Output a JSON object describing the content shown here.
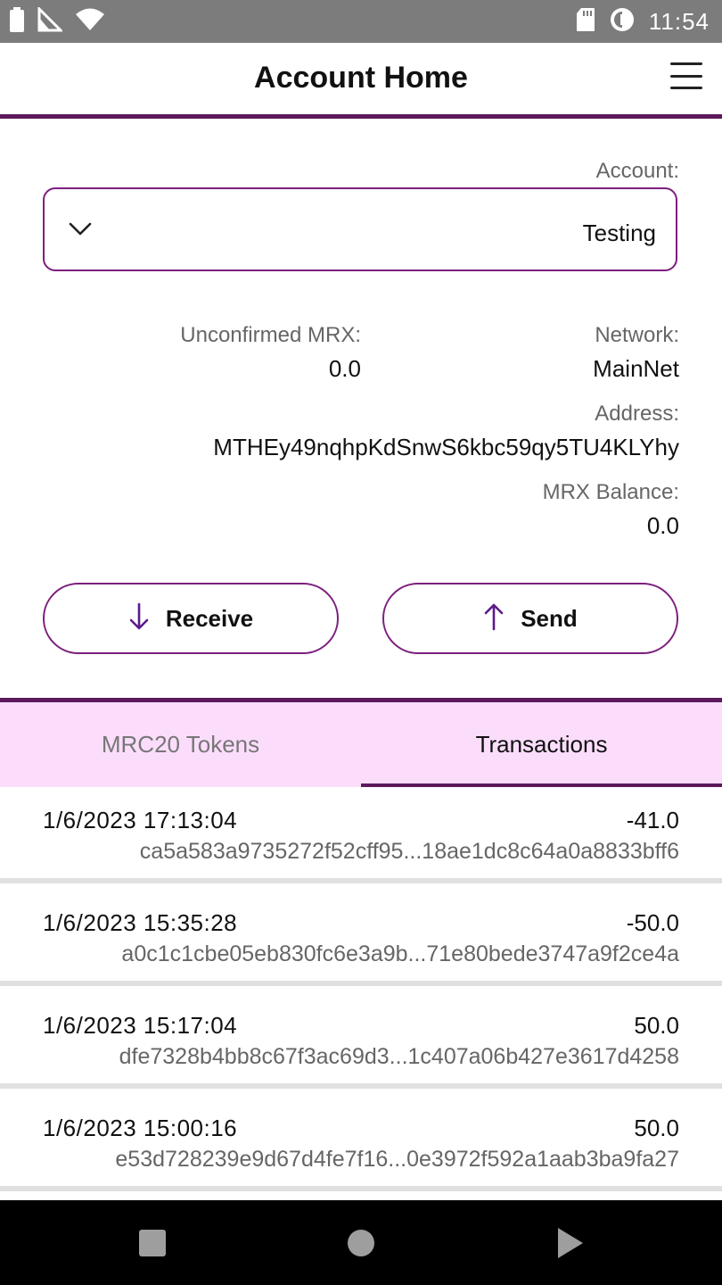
{
  "status_bar": {
    "time": "11:54",
    "icons_left": [
      "battery-icon",
      "signal-icon",
      "wifi-icon"
    ],
    "icons_right": [
      "sd-card-icon",
      "sync-icon"
    ]
  },
  "app_bar": {
    "title": "Account Home",
    "menu_icon": "hamburger-menu-icon"
  },
  "account": {
    "label": "Account:",
    "selected": "Testing"
  },
  "info": {
    "network_label": "Network:",
    "network_value": "MainNet",
    "unconfirmed_label": "Unconfirmed MRX:",
    "unconfirmed_value": "0.0",
    "address_label": "Address:",
    "address_value": "MTHEy49nqhpKdSnwS6kbc59qy5TU4KLYhy",
    "balance_label": "MRX Balance:",
    "balance_value": "0.0"
  },
  "actions": {
    "send_label": "Send",
    "receive_label": "Receive"
  },
  "tabs": {
    "transactions": "Transactions",
    "tokens": "MRC20 Tokens",
    "active": "Transactions"
  },
  "transactions": [
    {
      "amount": "-41.0",
      "date": "1/6/2023 17:13:04",
      "hash": "ca5a583a9735272f52cff95...18ae1dc8c64a0a8833bff6"
    },
    {
      "amount": "-50.0",
      "date": "1/6/2023 15:35:28",
      "hash": "a0c1c1cbe05eb830fc6e3a9b...71e80bede3747a9f2ce4a"
    },
    {
      "amount": "50.0",
      "date": "1/6/2023 15:17:04",
      "hash": "dfe7328b4bb8c67f3ac69d3...1c407a06b427e3617d4258"
    },
    {
      "amount": "50.0",
      "date": "1/6/2023 15:00:16",
      "hash": "e53d728239e9d67d4fe7f16...0e3972f592a1aab3ba9fa27"
    }
  ],
  "colors": {
    "accent": "#5c1a5c",
    "outline": "#7d1f7d",
    "tab_bg": "#fbddfb",
    "status_bar": "#7c7c7c"
  }
}
